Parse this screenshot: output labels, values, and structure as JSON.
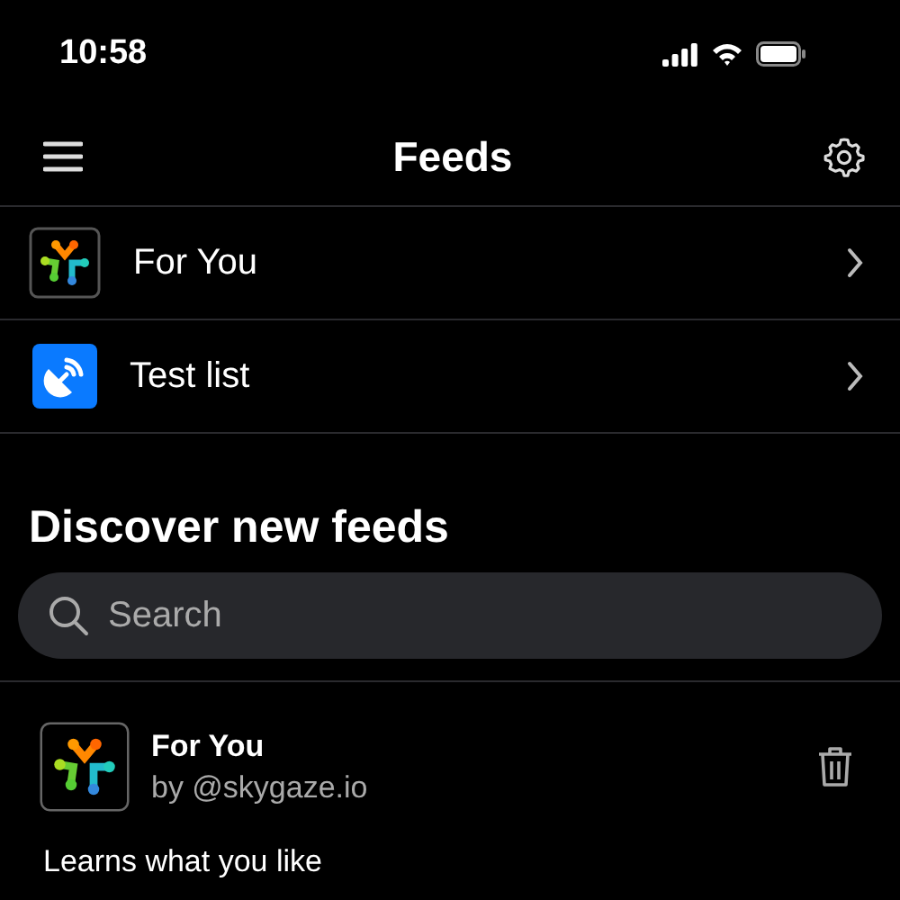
{
  "status_bar": {
    "time": "10:58"
  },
  "header": {
    "title": "Feeds"
  },
  "saved_feeds": [
    {
      "label": "For You",
      "kind": "skygaze"
    },
    {
      "label": "Test list",
      "kind": "list"
    }
  ],
  "discover": {
    "heading": "Discover new feeds",
    "search": {
      "placeholder": "Search"
    },
    "feeds": [
      {
        "name": "For You",
        "author": "by @skygaze.io",
        "description": "Learns what you like",
        "kind": "skygaze"
      }
    ]
  }
}
